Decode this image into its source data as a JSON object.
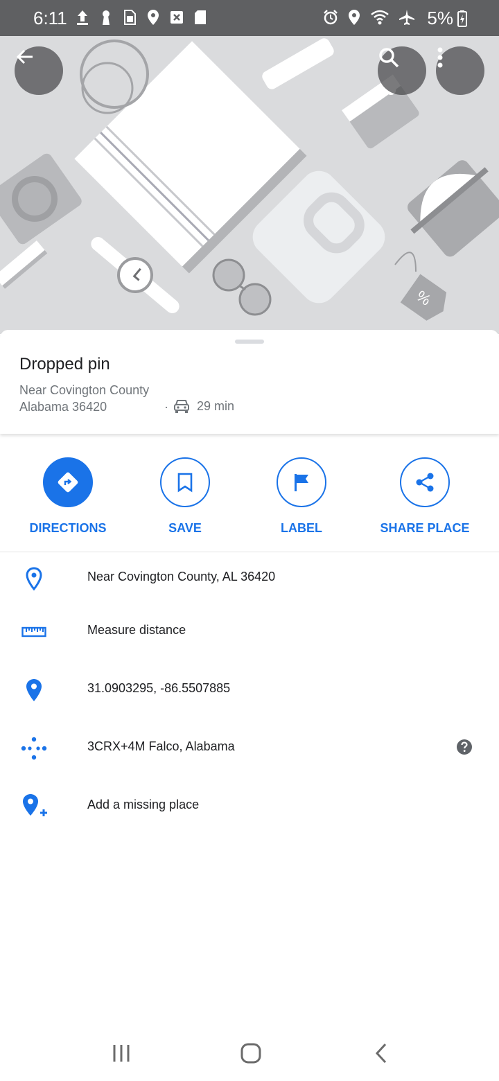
{
  "status_bar": {
    "time": "6:11",
    "battery": "5%",
    "left_icons": [
      "upload-icon",
      "keyhole-icon",
      "sim-icon",
      "location-icon",
      "image-x-icon",
      "sd-card-icon"
    ],
    "right_icons": [
      "alarm-icon",
      "location-icon",
      "wifi-icon",
      "airplane-icon",
      "battery-charging-icon"
    ]
  },
  "header": {
    "back_icon": "arrow-back-icon",
    "search_icon": "search-icon",
    "menu_icon": "more-vert-icon"
  },
  "place": {
    "title": "Dropped pin",
    "address_line1": "Near Covington County",
    "address_line2": "Alabama 36420",
    "separator": "·",
    "drive_time": "29 min",
    "drive_icon": "car-icon"
  },
  "actions": [
    {
      "label": "DIRECTIONS",
      "icon": "directions-icon"
    },
    {
      "label": "SAVE",
      "icon": "bookmark-icon"
    },
    {
      "label": "LABEL",
      "icon": "flag-icon"
    },
    {
      "label": "SHARE PLACE",
      "icon": "share-icon"
    }
  ],
  "details": [
    {
      "text": "Near Covington County, AL 36420",
      "icon": "location-outline-icon"
    },
    {
      "text": "Measure distance",
      "icon": "ruler-icon"
    },
    {
      "text": "31.0903295, -86.5507885",
      "icon": "location-pin-icon"
    },
    {
      "text": "3CRX+4M Falco, Alabama",
      "icon": "plus-code-icon",
      "help_icon": "help-icon"
    },
    {
      "text": "Add a missing place",
      "icon": "add-location-icon"
    }
  ],
  "colors": {
    "accent": "#1a73e8",
    "status_bar": "#5f6062",
    "hero_bg": "#dadbdd"
  },
  "nav_bar": {
    "recents_icon": "recents-icon",
    "home_icon": "home-icon",
    "back_icon": "nav-back-icon"
  }
}
